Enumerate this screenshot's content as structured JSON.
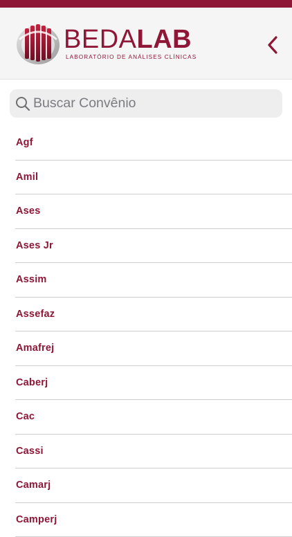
{
  "header": {
    "brand_part_1": "BEDA",
    "brand_part_2": "LAB",
    "brand_subtitle": "LABORATÓRIO DE ANÁLISES CLÍNICAS",
    "back_icon": "chevron-left-icon",
    "accent_color": "#8e1636"
  },
  "search": {
    "placeholder": "Buscar Convênio",
    "value": "",
    "icon": "search-icon"
  },
  "convenios": [
    "Agf",
    "Amil",
    "Ases",
    "Ases Jr",
    "Assim",
    "Assefaz",
    "Amafrej",
    "Caberj",
    "Cac",
    "Cassi",
    "Camarj",
    "Camperj"
  ]
}
